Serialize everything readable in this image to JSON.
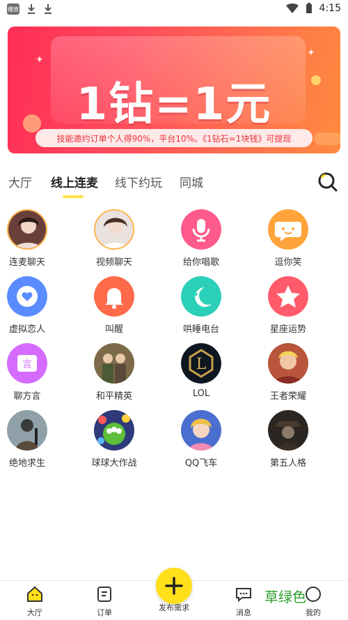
{
  "status_bar": {
    "app_badge": "播放",
    "time": "4:15"
  },
  "banner": {
    "headline": "1钻=1元",
    "subtitle": "技能邀约订单个人得90%，平台10%。《1钻石=1块钱》可提现"
  },
  "tabs": [
    {
      "label": "大厅"
    },
    {
      "label": "线上连麦"
    },
    {
      "label": "线下约玩"
    },
    {
      "label": "同城"
    }
  ],
  "categories": [
    {
      "label": "连麦聊天",
      "icon": "person-photo-avatar"
    },
    {
      "label": "视频聊天",
      "icon": "person-photo-avatar"
    },
    {
      "label": "给你唱歌",
      "icon": "microphone-icon",
      "color": "#ff5a8c"
    },
    {
      "label": "逗你笑",
      "icon": "chat-bubble-icon",
      "color": "#ffa43a"
    },
    {
      "label": "虚拟恋人",
      "icon": "heart-chat-icon",
      "color": "#5b8cff"
    },
    {
      "label": "叫醒",
      "icon": "bell-icon",
      "color": "#ff6a4a"
    },
    {
      "label": "哄睡电台",
      "icon": "moon-star-icon",
      "color": "#2ad1b8"
    },
    {
      "label": "星座运势",
      "icon": "star-icon",
      "color": "#ff5b6b"
    },
    {
      "label": "聊方言",
      "icon": "speech-icon",
      "color": "#d56bff"
    },
    {
      "label": "和平精英",
      "icon": "game-avatar"
    },
    {
      "label": "LOL",
      "icon": "lol-logo"
    },
    {
      "label": "王者荣耀",
      "icon": "game-avatar"
    },
    {
      "label": "绝地求生",
      "icon": "game-avatar"
    },
    {
      "label": "球球大作战",
      "icon": "game-avatar"
    },
    {
      "label": "QQ飞车",
      "icon": "game-avatar"
    },
    {
      "label": "第五人格",
      "icon": "game-avatar"
    }
  ],
  "bottom_nav": [
    {
      "label": "大厅",
      "icon": "home-icon"
    },
    {
      "label": "订单",
      "icon": "order-icon"
    },
    {
      "label": "发布需求",
      "icon": "plus-icon"
    },
    {
      "label": "消息",
      "icon": "message-icon"
    },
    {
      "label": "我的",
      "icon": "profile-icon"
    }
  ],
  "watermark": "草绿色",
  "colors": {
    "accent": "#ffe01a",
    "banner": "#ff3b5c"
  }
}
